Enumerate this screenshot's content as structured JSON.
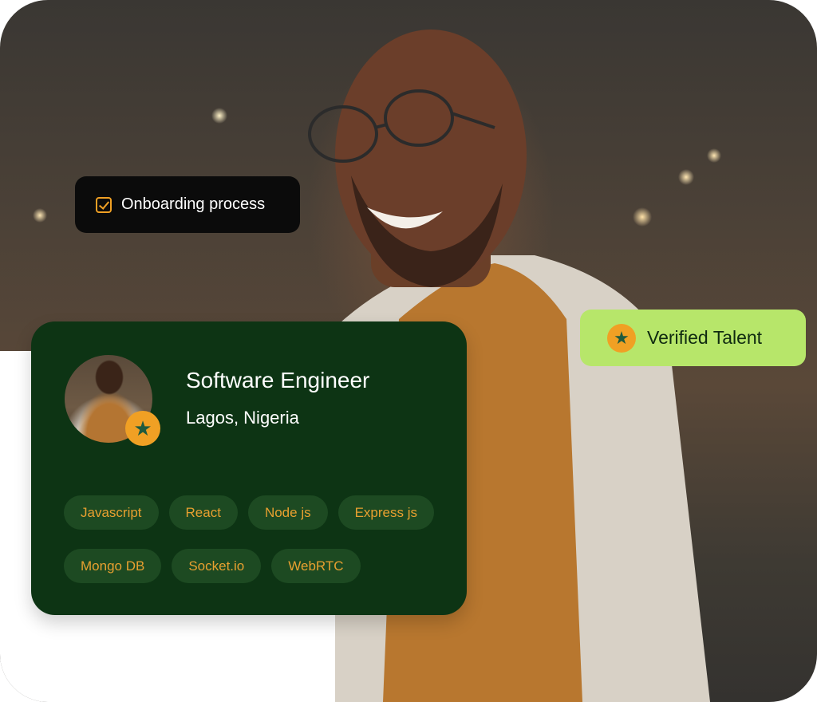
{
  "badges": {
    "onboarding": {
      "label": "Onboarding process",
      "icon": "checkbox-icon"
    },
    "verified": {
      "label": "Verified Talent",
      "icon": "star-icon"
    }
  },
  "profile": {
    "title": "Software Engineer",
    "location": "Lagos, Nigeria",
    "avatar_badge_icon": "star-icon",
    "skills": [
      "Javascript",
      "React",
      "Node js",
      "Express js",
      "Mongo DB",
      "Socket.io",
      "WebRTC"
    ]
  },
  "colors": {
    "card_bg": "#0d3414",
    "tag_bg": "#1d4a22",
    "tag_text": "#e8a030",
    "verified_bg": "#b7e66a",
    "accent_orange": "#f0a024",
    "onboarding_bg": "#0b0b0b"
  }
}
